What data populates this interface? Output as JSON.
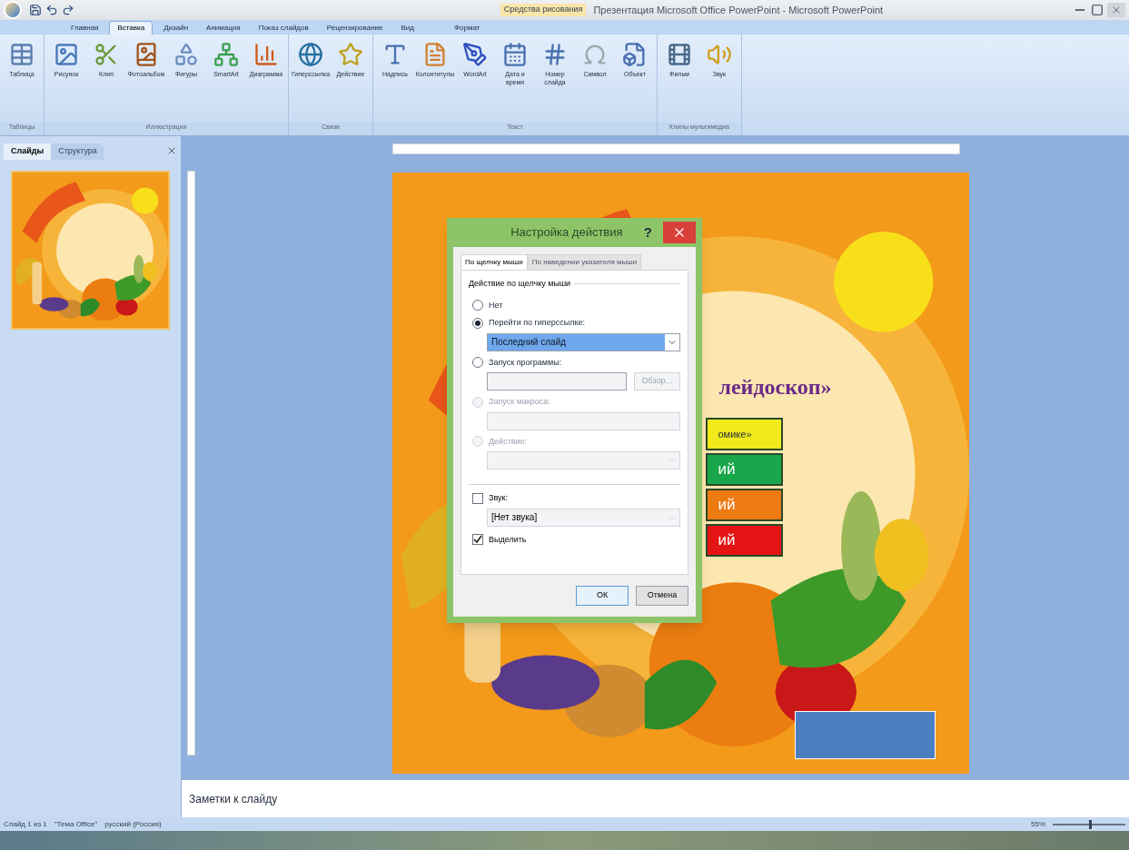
{
  "title_bar": {
    "context_tab": "Средства рисования",
    "title": "Презентация Microsoft Office PowerPoint - Microsoft PowerPoint"
  },
  "ribbon_tabs": [
    {
      "label": "Главная",
      "selected": false
    },
    {
      "label": "Вставка",
      "selected": true
    },
    {
      "label": "Дизайн",
      "selected": false
    },
    {
      "label": "Анимация",
      "selected": false
    },
    {
      "label": "Показ слайдов",
      "selected": false
    },
    {
      "label": "Рецензирование",
      "selected": false
    },
    {
      "label": "Вид",
      "selected": false
    },
    {
      "label": "Формат",
      "selected": false
    }
  ],
  "ribbon_groups": [
    {
      "name": "Таблицы",
      "buttons": [
        "Таблица"
      ]
    },
    {
      "name": "Иллюстрации",
      "buttons": [
        "Рисунок",
        "Клип",
        "Фотоальбом",
        "Фигуры",
        "SmartArt",
        "Диаграмма"
      ]
    },
    {
      "name": "Связи",
      "buttons": [
        "Гиперссылка",
        "Действие"
      ]
    },
    {
      "name": "Текст",
      "buttons": [
        "Надпись",
        "Колонтитулы",
        "WordArt",
        "Дата и время",
        "Номер слайда",
        "Символ",
        "Объект"
      ]
    },
    {
      "name": "Клипы мультимедиа",
      "buttons": [
        "Фильм",
        "Звук"
      ]
    }
  ],
  "slides_pane": {
    "tabs": [
      {
        "label": "Слайды",
        "selected": true
      },
      {
        "label": "Структура",
        "selected": false
      }
    ]
  },
  "slide": {
    "title_fragment": "лейдоскоп»",
    "menu_buttons": [
      {
        "label": "омике»",
        "color": "#f2ea1a"
      },
      {
        "label": "ий",
        "color": "#1aa64a"
      },
      {
        "label": "ий",
        "color": "#ee7a12"
      },
      {
        "label": "ий",
        "color": "#e51414"
      }
    ]
  },
  "dialog": {
    "title": "Настройка действия",
    "help": "?",
    "tabs": [
      {
        "label": "По щелчку мыши",
        "selected": true
      },
      {
        "label": "По наведении указателя мыши",
        "selected": false
      }
    ],
    "group_label": "Действие по щелчку мыши",
    "options": [
      {
        "label": "Нет",
        "selected": false,
        "disabled": false
      },
      {
        "label": "Перейти по гиперссылке:",
        "selected": true,
        "disabled": false,
        "field": {
          "kind": "select",
          "value": "Последний слайд"
        }
      },
      {
        "label": "Запуск программы:",
        "selected": false,
        "disabled": false,
        "field": {
          "kind": "input",
          "button": "Обзор..."
        }
      },
      {
        "label": "Запуск макроса:",
        "selected": false,
        "disabled": true,
        "field": {
          "kind": "input"
        }
      },
      {
        "label": "Действие:",
        "selected": false,
        "disabled": true,
        "field": {
          "kind": "select"
        }
      }
    ],
    "sound": {
      "label": "Звук:",
      "checked": false,
      "value": "[Нет звука]"
    },
    "highlight": {
      "label": "Выделить",
      "checked": true
    },
    "buttons": [
      "ОК",
      "Отмена"
    ]
  },
  "notes": {
    "text": "Заметки к слайду"
  },
  "status_bar": {
    "items": [
      "Слайд 1 из 1",
      "\"Тема Office\"",
      "русский (Россия)"
    ],
    "zoom": "55%",
    "zoom_slider": {
      "level": 0.5
    }
  }
}
